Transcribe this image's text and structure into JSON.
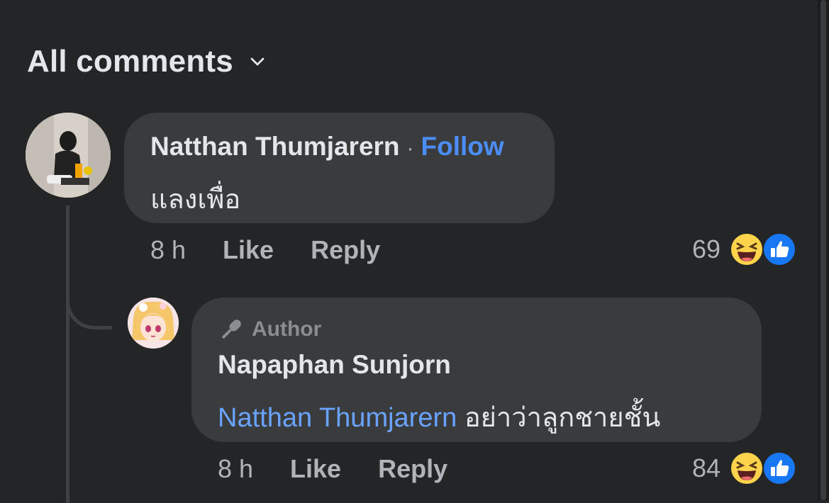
{
  "header": {
    "title": "All comments",
    "dropdown_icon": "chevron-down-icon"
  },
  "comments": [
    {
      "author": "Natthan Thumjarern",
      "follow_label": "Follow",
      "separator": "·",
      "text": "แลงเพื่อ",
      "time": "8 h",
      "like_label": "Like",
      "reply_label": "Reply",
      "reaction_count": "69",
      "reactions": [
        "haha-icon",
        "like-icon"
      ]
    }
  ],
  "replies": [
    {
      "badge": "Author",
      "badge_icon": "microphone-icon",
      "author": "Napaphan Sunjorn",
      "mention": "Natthan Thumjarern",
      "text": "อย่าว่าลูกชายชั้น",
      "time": "8 h",
      "like_label": "Like",
      "reply_label": "Reply",
      "reaction_count": "84",
      "reactions": [
        "haha-icon",
        "like-icon"
      ]
    }
  ],
  "colors": {
    "background": "#242526",
    "bubble": "#3a3b3c",
    "link": "#4b8cf5",
    "mention": "#6aa3ff",
    "secondary_text": "#b0b3b8"
  }
}
